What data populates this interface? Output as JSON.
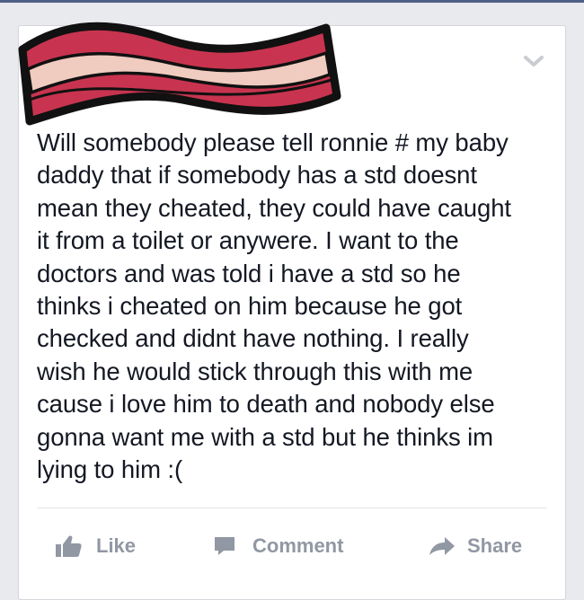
{
  "post": {
    "text": "Will somebody please tell ronnie # my baby\ndaddy that if somebody has a std doesnt\nmean they cheated, they could have caught\nit from a toilet or anywere. I want to the\ndoctors and was told i have a std so he\nthinks i cheated on him because he got\nchecked and didnt have nothing. I really\nwish he would stick through this with me\ncause i love him to death and nobody else\ngonna want me with a std but he thinks im\nlying to him :("
  },
  "actions": {
    "like_label": "Like",
    "comment_label": "Comment",
    "share_label": "Share"
  },
  "icons": {
    "redaction": "bacon-strip-redaction",
    "menu": "chevron-down-icon",
    "like": "thumbs-up-icon",
    "comment": "speech-bubble-icon",
    "share": "share-arrow-icon"
  },
  "colors": {
    "page_background": "#e9eaed",
    "card_background": "#ffffff",
    "post_text": "#141823",
    "action_text": "#9197a3",
    "bacon_red": "#c8344f",
    "bacon_cream": "#f0cbbf"
  }
}
